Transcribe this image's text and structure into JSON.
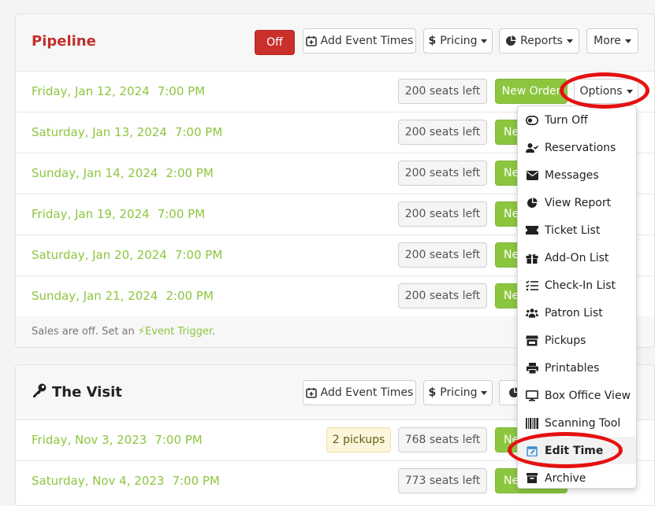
{
  "colors": {
    "accent_green": "#8cc63f",
    "danger_red": "#c9302c",
    "title_red": "#c0302b",
    "annotation_red": "#e51111"
  },
  "pipeline": {
    "title": "Pipeline",
    "toggle_label": "Off",
    "add_event_times_label": "Add Event Times",
    "pricing_label": "Pricing",
    "reports_label": "Reports",
    "more_label": "More",
    "new_order_label": "New Order",
    "new_order_truncated": "Ne",
    "options_label": "Options",
    "rows": [
      {
        "date": "Friday, Jan 12, 2024",
        "time": "7:00 PM",
        "seats": "200 seats left"
      },
      {
        "date": "Saturday, Jan 13, 2024",
        "time": "7:00 PM",
        "seats": "200 seats left"
      },
      {
        "date": "Sunday, Jan 14, 2024",
        "time": "2:00 PM",
        "seats": "200 seats left"
      },
      {
        "date": "Friday, Jan 19, 2024",
        "time": "7:00 PM",
        "seats": "200 seats left"
      },
      {
        "date": "Saturday, Jan 20, 2024",
        "time": "7:00 PM",
        "seats": "200 seats left"
      },
      {
        "date": "Sunday, Jan 21, 2024",
        "time": "2:00 PM",
        "seats": "200 seats left"
      }
    ],
    "footer": {
      "text": "Sales are off. Set an",
      "link": "Event Trigger",
      "suffix": "."
    }
  },
  "visit": {
    "title": "The Visit",
    "title_icon": "key-icon",
    "add_event_times_label": "Add Event Times",
    "pricing_label": "Pricing",
    "new_order_truncated": "Ne",
    "rows": [
      {
        "date": "Friday, Nov 3, 2023",
        "time": "7:00 PM",
        "pickups": "2 pickups",
        "seats": "768 seats left"
      },
      {
        "date": "Saturday, Nov 4, 2023",
        "time": "7:00 PM",
        "seats": "773 seats left"
      }
    ]
  },
  "options_menu": {
    "items": [
      {
        "label": "Turn Off",
        "icon": "toggle-icon"
      },
      {
        "label": "Reservations",
        "icon": "user-check-icon"
      },
      {
        "label": "Messages",
        "icon": "envelope-icon"
      },
      {
        "label": "View Report",
        "icon": "pie-chart-icon"
      },
      {
        "label": "Ticket List",
        "icon": "ticket-icon"
      },
      {
        "label": "Add-On List",
        "icon": "gift-icon"
      },
      {
        "label": "Check-In List",
        "icon": "checklist-icon"
      },
      {
        "label": "Patron List",
        "icon": "users-icon"
      },
      {
        "label": "Pickups",
        "icon": "store-icon"
      },
      {
        "label": "Printables",
        "icon": "printer-icon"
      },
      {
        "label": "Box Office View",
        "icon": "monitor-icon"
      },
      {
        "label": "Scanning Tool",
        "icon": "barcode-icon"
      },
      {
        "label": "Edit Time",
        "icon": "calendar-edit-icon"
      },
      {
        "label": "Archive",
        "icon": "archive-icon"
      }
    ]
  }
}
